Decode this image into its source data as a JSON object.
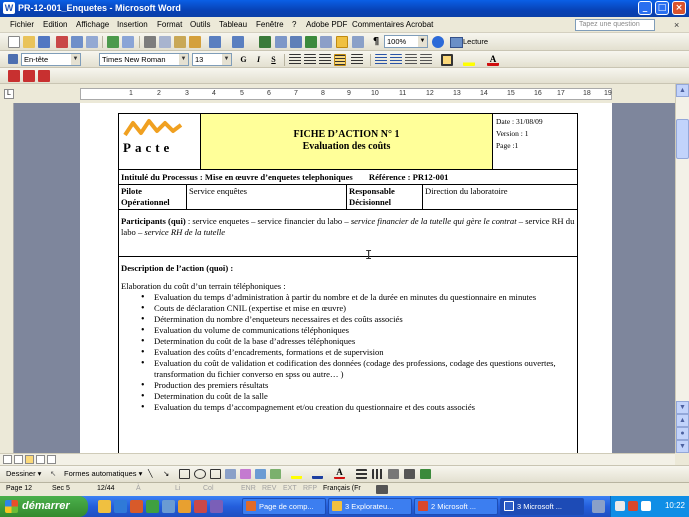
{
  "window": {
    "title": "PR-12-001_Enquetes - Microsoft Word",
    "minimize": "_",
    "maximize": "□",
    "close": "×"
  },
  "menu": {
    "items": [
      "Fichier",
      "Edition",
      "Affichage",
      "Insertion",
      "Format",
      "Outils",
      "Tableau",
      "Fenêtre",
      "?",
      "Adobe PDF",
      "Commentaires Acrobat"
    ],
    "help_placeholder": "Tapez une question",
    "doc_close": "×"
  },
  "toolbar_standard": {
    "zoom": "100%",
    "lecture": "Lecture"
  },
  "toolbar_format": {
    "style": "En-tête",
    "font": "Times New Roman",
    "size": "13",
    "bold": "G",
    "italic": "I",
    "underline": "S"
  },
  "ruler": {
    "corner": "L",
    "numbers": [
      "1",
      "2",
      "3",
      "4",
      "5",
      "6",
      "7",
      "8",
      "9",
      "10",
      "11",
      "12",
      "13",
      "14",
      "15",
      "16",
      "17",
      "18",
      "19"
    ]
  },
  "document": {
    "logo_text": "Pacte",
    "fiche_title": "FICHE D’ACTION N° 1",
    "fiche_subtitle": "Evaluation des coûts",
    "date": "Date : 31/08/09",
    "version": "Version : 1",
    "page": "Page :1",
    "intitule_label": "Intitulé du Processus :",
    "intitule_value": " Mise en œuvre d’enquetes telephoniques",
    "reference_label": "Référence : PR12-001",
    "pilote_label": "Pilote Opérationnel",
    "pilote_value": "Service enquêtes",
    "responsable_label": "Responsable Décisionnel",
    "responsable_value": "Direction du laboratoire",
    "participants_label": "Participants (qui)",
    "participants_part1": " : service enquetes – service financier du labo – ",
    "participants_italic1": "service financier de la tutelle qui gère le contrat",
    "participants_part2": " – service RH du labo – ",
    "participants_italic2": "service RH de la tutelle",
    "description_label": "Description de l’action (quoi) :",
    "elaboration": "Elaboration du coût d’un terrain téléphoniques :",
    "bullets": [
      "Evaluation du temps d’administration à partir du nombre et de la durée en minutes du questionnaire en minutes",
      "Couts de déclaration CNIL (expertise et mise en œuvre)",
      "Détermination du nombre d’enqueteurs necessaires et des coûts associés",
      "Evaluation du volume de communications téléphoniques",
      "Determination du coût de la base d’adresses téléphoniques",
      "Evaluation des coûts d’encadrements, formations et de supervision",
      "Evaluation du coût de validation et codification des données (codage des professions, codage des questions ouvertes, transformation du fichier converso en spss ou autre… )",
      "Production des premiers résultats",
      "Determination du coût de la salle",
      "Evaluation du temps d’accompagnement et/ou creation du questionnaire et des couts associés"
    ]
  },
  "drawing_toolbar": {
    "dessiner": "Dessiner ▾",
    "formes": "Formes automatiques ▾"
  },
  "status": {
    "page": "Page 12",
    "section": "Sec 5",
    "count": "12/44",
    "a": "À",
    "li": "Li",
    "col": "Col",
    "enr": "ENR",
    "rev": "REV",
    "ext": "EXT",
    "rfp": "RFP",
    "lang": "Français (Fr"
  },
  "taskbar": {
    "start": "démarrer",
    "tasks": [
      "Page de comp...",
      "3 Explorateu...",
      "2 Microsoft ...",
      "3 Microsoft ..."
    ],
    "clock": "10:22"
  },
  "colors": {
    "title_bar": "#0842b6",
    "yellow_header": "#ffff99",
    "logo_orange": "#f0a020",
    "taskbar_blue": "#245edc",
    "start_green": "#338a2e"
  }
}
